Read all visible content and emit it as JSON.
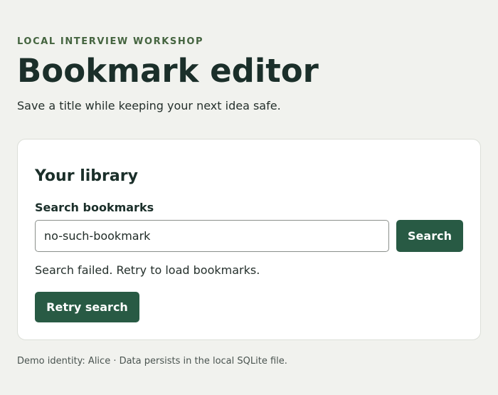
{
  "header": {
    "eyebrow": "LOCAL INTERVIEW WORKSHOP",
    "title": "Bookmark editor",
    "subtitle": "Save a title while keeping your next idea safe."
  },
  "library": {
    "heading": "Your library",
    "search_label": "Search bookmarks",
    "search_value": "no-such-bookmark",
    "search_button_label": "Search",
    "status_message": "Search failed. Retry to load bookmarks.",
    "retry_button_label": "Retry search"
  },
  "footer": {
    "note": "Demo identity: Alice · Data persists in the local SQLite file."
  },
  "colors": {
    "background": "#f1f2ee",
    "accent": "#285a44",
    "eyebrow": "#44643f",
    "card": "#ffffff"
  }
}
